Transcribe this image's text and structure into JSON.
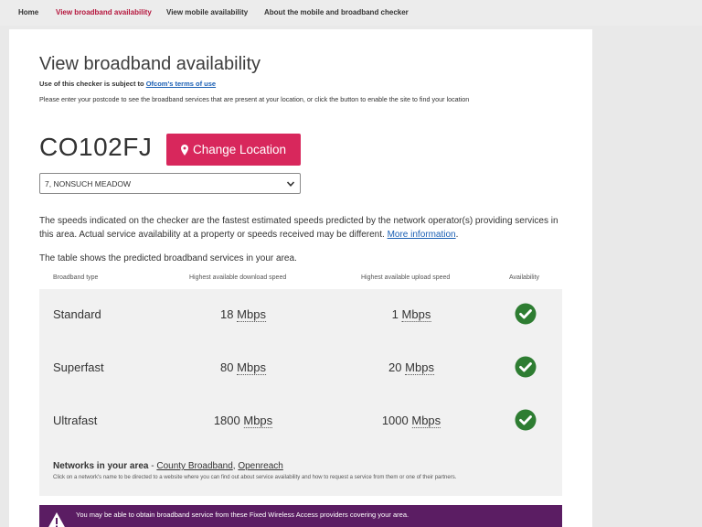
{
  "nav": {
    "items": [
      {
        "label": "Home",
        "active": false
      },
      {
        "label": "View broadband availability",
        "active": true
      },
      {
        "label": "View mobile availability",
        "active": false
      },
      {
        "label": "About the mobile and broadband checker",
        "active": false
      }
    ]
  },
  "page": {
    "title": "View broadband availability",
    "terms_prefix": "Use of this checker is subject to ",
    "terms_link": "Ofcom's terms of use",
    "intro": "Please enter your postcode to see the broadband services that are present at your location, or click the button to enable the site to find your location"
  },
  "location": {
    "postcode": "CO102FJ",
    "change_button": "Change Location",
    "address_selected": "7, NONSUCH MEADOW"
  },
  "info": {
    "speeds_text": "The speeds indicated on the checker are the fastest estimated speeds predicted by the network operator(s) providing services in this area. Actual service availability at a property or speeds received may be different. ",
    "more_info_link": "More information",
    "table_intro": "The table shows the predicted broadband services in your area."
  },
  "table": {
    "headers": {
      "type": "Broadband type",
      "download": "Highest available download speed",
      "upload": "Highest available upload speed",
      "availability": "Availability"
    },
    "rows": [
      {
        "type": "Standard",
        "download_value": "18",
        "download_unit": "Mbps",
        "upload_value": "1",
        "upload_unit": "Mbps",
        "available": true
      },
      {
        "type": "Superfast",
        "download_value": "80",
        "download_unit": "Mbps",
        "upload_value": "20",
        "upload_unit": "Mbps",
        "available": true
      },
      {
        "type": "Ultrafast",
        "download_value": "1800",
        "download_unit": "Mbps",
        "upload_value": "1000",
        "upload_unit": "Mbps",
        "available": true
      }
    ]
  },
  "networks": {
    "label": "Networks in your area",
    "separator": " - ",
    "providers": [
      "County Broadband",
      "Openreach"
    ],
    "note": "Click on a network's name to be directed to a website where you can find out about service availability and how to request a service from them or one of their partners."
  },
  "fwa": {
    "text": "You may be able to obtain broadband service from these Fixed Wireless Access providers covering your area."
  },
  "colors": {
    "accent": "#d8275c",
    "active_nav": "#b5163d",
    "check": "#2e7d32",
    "banner": "#5b1d63",
    "link": "#1a5fb4"
  },
  "icons": {
    "pin": "map-marker-icon",
    "chevron": "chevron-down-icon",
    "check": "check-circle-icon",
    "warning": "warning-triangle-icon"
  }
}
